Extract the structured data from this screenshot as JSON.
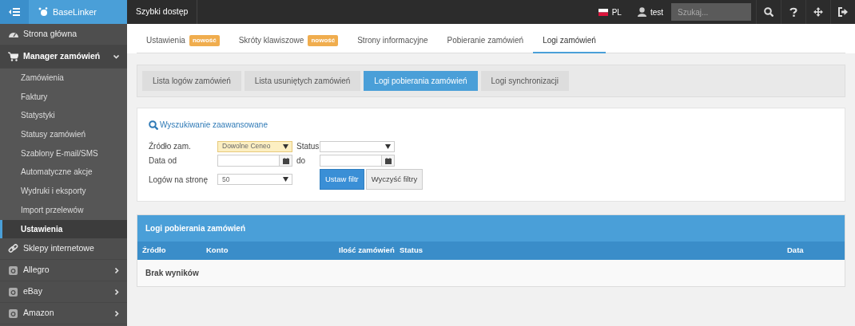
{
  "topbar": {
    "brand": "BaseLinker",
    "quick_access": "Szybki dostęp",
    "language": "PL",
    "user": "test",
    "search": {
      "placeholder": "Szukaj..."
    }
  },
  "sidebar": {
    "items": [
      {
        "label": "Strona główna",
        "expanded": false
      },
      {
        "label": "Manager zamówień",
        "expanded": true,
        "children": [
          {
            "label": "Zamówienia",
            "selected": false
          },
          {
            "label": "Faktury",
            "selected": false
          },
          {
            "label": "Statystyki",
            "selected": false
          },
          {
            "label": "Statusy zamówień",
            "selected": false
          },
          {
            "label": "Szablony E-mail/SMS",
            "selected": false
          },
          {
            "label": "Automatyczne akcje",
            "selected": false
          },
          {
            "label": "Wydruki i eksporty",
            "selected": false
          },
          {
            "label": "Import przelewów",
            "selected": false
          },
          {
            "label": "Ustawienia",
            "selected": true
          }
        ]
      },
      {
        "label": "Sklepy internetowe",
        "expanded": false
      },
      {
        "label": "Allegro",
        "expanded": false,
        "has_submenu": true
      },
      {
        "label": "eBay",
        "expanded": false,
        "has_submenu": true
      },
      {
        "label": "Amazon",
        "expanded": false,
        "has_submenu": true
      }
    ]
  },
  "tabs": [
    {
      "label": "Ustawienia",
      "badge": "nowość",
      "selected": false
    },
    {
      "label": "Skróty klawiszowe",
      "badge": "nowość",
      "selected": false
    },
    {
      "label": "Strony informacyjne",
      "selected": false
    },
    {
      "label": "Pobieranie zamówień",
      "selected": false
    },
    {
      "label": "Logi zamówień",
      "selected": true
    }
  ],
  "subtabs": [
    {
      "label": "Lista logów zamówień",
      "selected": false
    },
    {
      "label": "Lista usuniętych zamówień",
      "selected": false
    },
    {
      "label": "Logi pobierania zamówień",
      "selected": true
    },
    {
      "label": "Logi synchronizacji",
      "selected": false
    }
  ],
  "filter": {
    "title": "Wyszukiwanie zaawansowane",
    "source": {
      "label": "Źródło zam.",
      "value": "Dowolne Ceneo",
      "active": true
    },
    "status": {
      "label": "Status",
      "active": false
    },
    "date_from": {
      "label": "Data od"
    },
    "date_to": {
      "label": "do"
    },
    "per_page": {
      "label": "Logów na stronę",
      "value": "50",
      "active": false
    },
    "buttons": [
      {
        "label": "Ustaw filtr",
        "kind": "primary"
      },
      {
        "label": "Wyczyść filtry",
        "kind": "secondary"
      }
    ]
  },
  "table": {
    "title": "Logi pobierania zamówień",
    "columns": [
      "Źródło",
      "Konto",
      "Ilość zamówień",
      "Status",
      "Data"
    ],
    "empty_message": "Brak wyników"
  }
}
